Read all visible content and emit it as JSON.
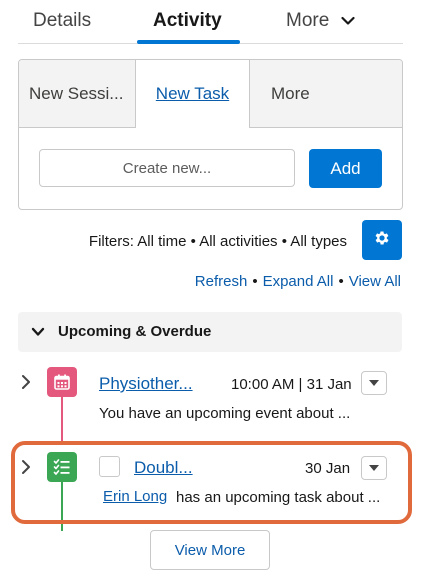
{
  "top_tabs": {
    "details": "Details",
    "activity": "Activity",
    "more": "More"
  },
  "composer": {
    "tabs": [
      "New Sessi...",
      "New Task",
      "More"
    ],
    "input_placeholder": "Create new...",
    "add_label": "Add"
  },
  "filters": {
    "text": "Filters: All time • All activities • All types",
    "refresh": "Refresh",
    "expand_all": "Expand All",
    "view_all": "View All",
    "separator": "•"
  },
  "section": {
    "title": "Upcoming & Overdue"
  },
  "items": [
    {
      "title": "Physiother...",
      "date": "10:00 AM | 31 Jan",
      "description": "You have an upcoming event about ...",
      "icon": "calendar-icon",
      "color": "#e3587c"
    },
    {
      "title": "Doubl...",
      "date": "30 Jan",
      "person": "Erin Long",
      "description": "has an upcoming task about ...",
      "icon": "task-list-icon",
      "color": "#3ba755"
    }
  ],
  "view_more": "View More",
  "colors": {
    "brand": "#0176d3",
    "link": "#0b5cab",
    "highlight": "#e06a3c"
  }
}
